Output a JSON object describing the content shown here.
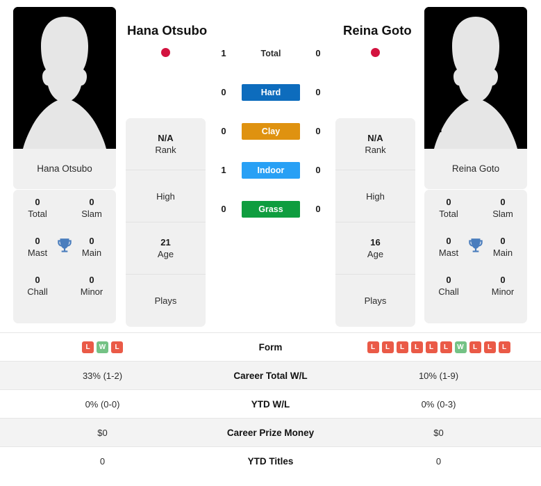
{
  "players": {
    "left": {
      "name": "Hana Otsubo",
      "photo_caption": "Hana Otsubo",
      "country_color": "#d3133f",
      "info": [
        {
          "value": "N/A",
          "label": "Rank"
        },
        {
          "value": "",
          "label": "High"
        },
        {
          "value": "21",
          "label": "Age"
        },
        {
          "value": "",
          "label": "Plays"
        }
      ],
      "titles": [
        {
          "num": "0",
          "label": "Total"
        },
        {
          "num": "0",
          "label": "Slam"
        },
        {
          "num": "0",
          "label": "Mast"
        },
        {
          "num": "0",
          "label": "Main"
        },
        {
          "num": "0",
          "label": "Chall"
        },
        {
          "num": "0",
          "label": "Minor"
        }
      ],
      "form": [
        "L",
        "W",
        "L"
      ],
      "career_total_wl": "33% (1-2)",
      "ytd_wl": "0% (0-0)",
      "career_prize_money": "$0",
      "ytd_titles": "0"
    },
    "right": {
      "name": "Reina Goto",
      "photo_caption": "Reina Goto",
      "country_color": "#d3133f",
      "info": [
        {
          "value": "N/A",
          "label": "Rank"
        },
        {
          "value": "",
          "label": "High"
        },
        {
          "value": "16",
          "label": "Age"
        },
        {
          "value": "",
          "label": "Plays"
        }
      ],
      "titles": [
        {
          "num": "0",
          "label": "Total"
        },
        {
          "num": "0",
          "label": "Slam"
        },
        {
          "num": "0",
          "label": "Mast"
        },
        {
          "num": "0",
          "label": "Main"
        },
        {
          "num": "0",
          "label": "Chall"
        },
        {
          "num": "0",
          "label": "Minor"
        }
      ],
      "form": [
        "L",
        "L",
        "L",
        "L",
        "L",
        "L",
        "W",
        "L",
        "L",
        "L"
      ],
      "career_total_wl": "10% (1-9)",
      "ytd_wl": "0% (0-3)",
      "career_prize_money": "$0",
      "ytd_titles": "0"
    }
  },
  "head_to_head": [
    {
      "label": "Total",
      "left": "1",
      "right": "0",
      "badge": false,
      "color": ""
    },
    {
      "label": "Hard",
      "left": "0",
      "right": "0",
      "badge": true,
      "color": "#0d6cbd"
    },
    {
      "label": "Clay",
      "left": "0",
      "right": "0",
      "badge": true,
      "color": "#df9210"
    },
    {
      "label": "Indoor",
      "left": "1",
      "right": "0",
      "badge": true,
      "color": "#28a0f5"
    },
    {
      "label": "Grass",
      "left": "0",
      "right": "0",
      "badge": true,
      "color": "#0f9d3f"
    }
  ],
  "stats_rows": [
    {
      "label": "Form",
      "left": "",
      "right": "",
      "form": true
    },
    {
      "label": "Career Total W/L",
      "left": "33% (1-2)",
      "right": "10% (1-9)",
      "form": false
    },
    {
      "label": "YTD W/L",
      "left": "0% (0-0)",
      "right": "0% (0-3)",
      "form": false
    },
    {
      "label": "Career Prize Money",
      "left": "$0",
      "right": "$0",
      "form": false
    },
    {
      "label": "YTD Titles",
      "left": "0",
      "right": "0",
      "form": false
    }
  ],
  "colors": {
    "card_bg": "#f0f0f0",
    "win_badge": "#74c285",
    "loss_badge": "#ea5a47"
  }
}
